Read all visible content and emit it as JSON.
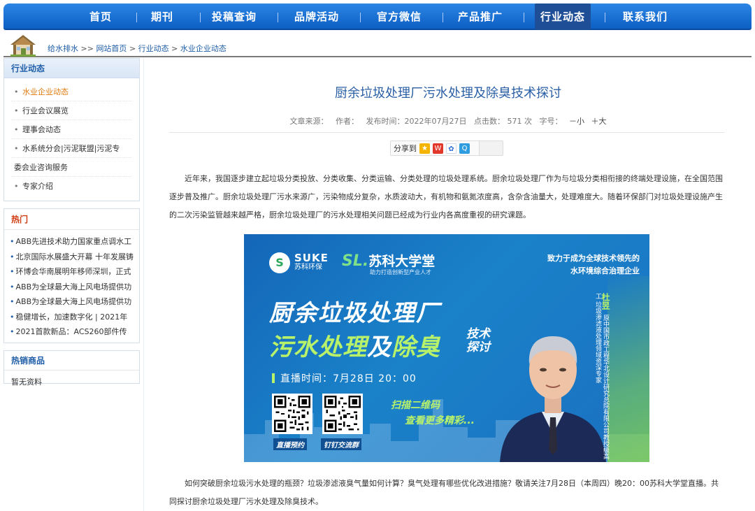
{
  "nav": {
    "items": [
      {
        "label": "首页",
        "active": false
      },
      {
        "label": "期刊",
        "active": false
      },
      {
        "label": "投稿查询",
        "active": false
      },
      {
        "label": "品牌活动",
        "active": false
      },
      {
        "label": "官方微信",
        "active": false
      },
      {
        "label": "产品推广",
        "active": false
      },
      {
        "label": "行业动态",
        "active": true
      },
      {
        "label": "联系我们",
        "active": false
      }
    ]
  },
  "breadcrumb": {
    "site": "给水排水",
    "sep1": ">>",
    "home": "网站首页",
    "sep2": ">",
    "section": "行业动态",
    "sep3": ">",
    "current": "水业企业动态"
  },
  "sidebar": {
    "title": "行业动态",
    "items": [
      {
        "label": "水业企业动态",
        "active": true
      },
      {
        "label": "行业会议展览",
        "active": false
      },
      {
        "label": "理事会动态",
        "active": false
      },
      {
        "label": "水系统分会|污泥联盟|污泥专",
        "active": false
      },
      {
        "label": "委会业咨询服务",
        "active": false
      },
      {
        "label": "专家介绍",
        "active": false
      }
    ]
  },
  "hot": {
    "title": "热门",
    "items": [
      "ABB先进技术助力国家重点调水工",
      "北京国际水展盛大开幕 十年发展铸",
      "环博会华南展明年移师深圳，正式",
      "ABB为全球最大海上风电场提供功",
      "ABB为全球最大海上风电场提供功",
      "稳健增长，加速数字化 | 2021年",
      "2021首款新品：ACS260部件传"
    ]
  },
  "hotsale": {
    "title": "热销商品",
    "empty": "暂无资料"
  },
  "article": {
    "title": "厨余垃圾处理厂污水处理及除臭技术探讨",
    "source_label": "文章来源：",
    "author_label": "作者：",
    "date": "发布时间：2022年07月27日",
    "clicks": "点击数：  571 次",
    "fontsize_label": "字号：",
    "font_small": "－小",
    "font_large": "＋大",
    "share_label": "分享到",
    "para1": "近年来，我国逐步建立起垃圾分类投放、分类收集、分类运输、分类处理的垃圾处理系统。厨余垃圾处理厂作为与垃圾分类相衔接的终端处理设施，在全国范围逐步普及推广。厨余垃圾处理厂污水来源广，污染物成分复杂，水质波动大，有机物和氨氮浓度高，含杂含油量大，处理难度大。随着环保部门对垃圾处理设施产生的二次污染监管越来越严格，厨余垃圾处理厂的污水处理相关问题已经成为行业内各高度重视的研究课题。",
    "para2": "如何突破厨余垃圾污水处理的瓶颈？垃圾渗滤液臭气量如何计算？臭气处理有哪些优化改进措施？敬请关注7月28日（本周四）晚20：00苏科大学堂直播。共同探讨厨余垃圾处理厂污水处理及除臭技术。"
  },
  "banner": {
    "logo_en": "SUKE",
    "logo_cn": "苏科环保",
    "academy_mark": "SL.",
    "academy_name": "苏科大学堂",
    "academy_sub": "助力打造创新型产业人才",
    "slogan1": "致力于成为全球技术领先的",
    "slogan2": "水环境综合治理企业",
    "title1": "厨余垃圾处理厂",
    "title2a": "污水处理",
    "title2b": "及",
    "title2c": "除臭",
    "title3a": "技术",
    "title3b": "探讨",
    "time": "直播时间：7月28日  20：00",
    "qr1_caption": "直播预约",
    "qr2_caption": "钉钉交流群",
    "scan1": "扫描二维码",
    "scan2": "查看更多精彩...",
    "speaker_name": "杜昱",
    "speaker_title": "原中国市政工程华北设计研究总院有限公司教授级高工 垃圾渗滤液处理领域资深专家"
  }
}
